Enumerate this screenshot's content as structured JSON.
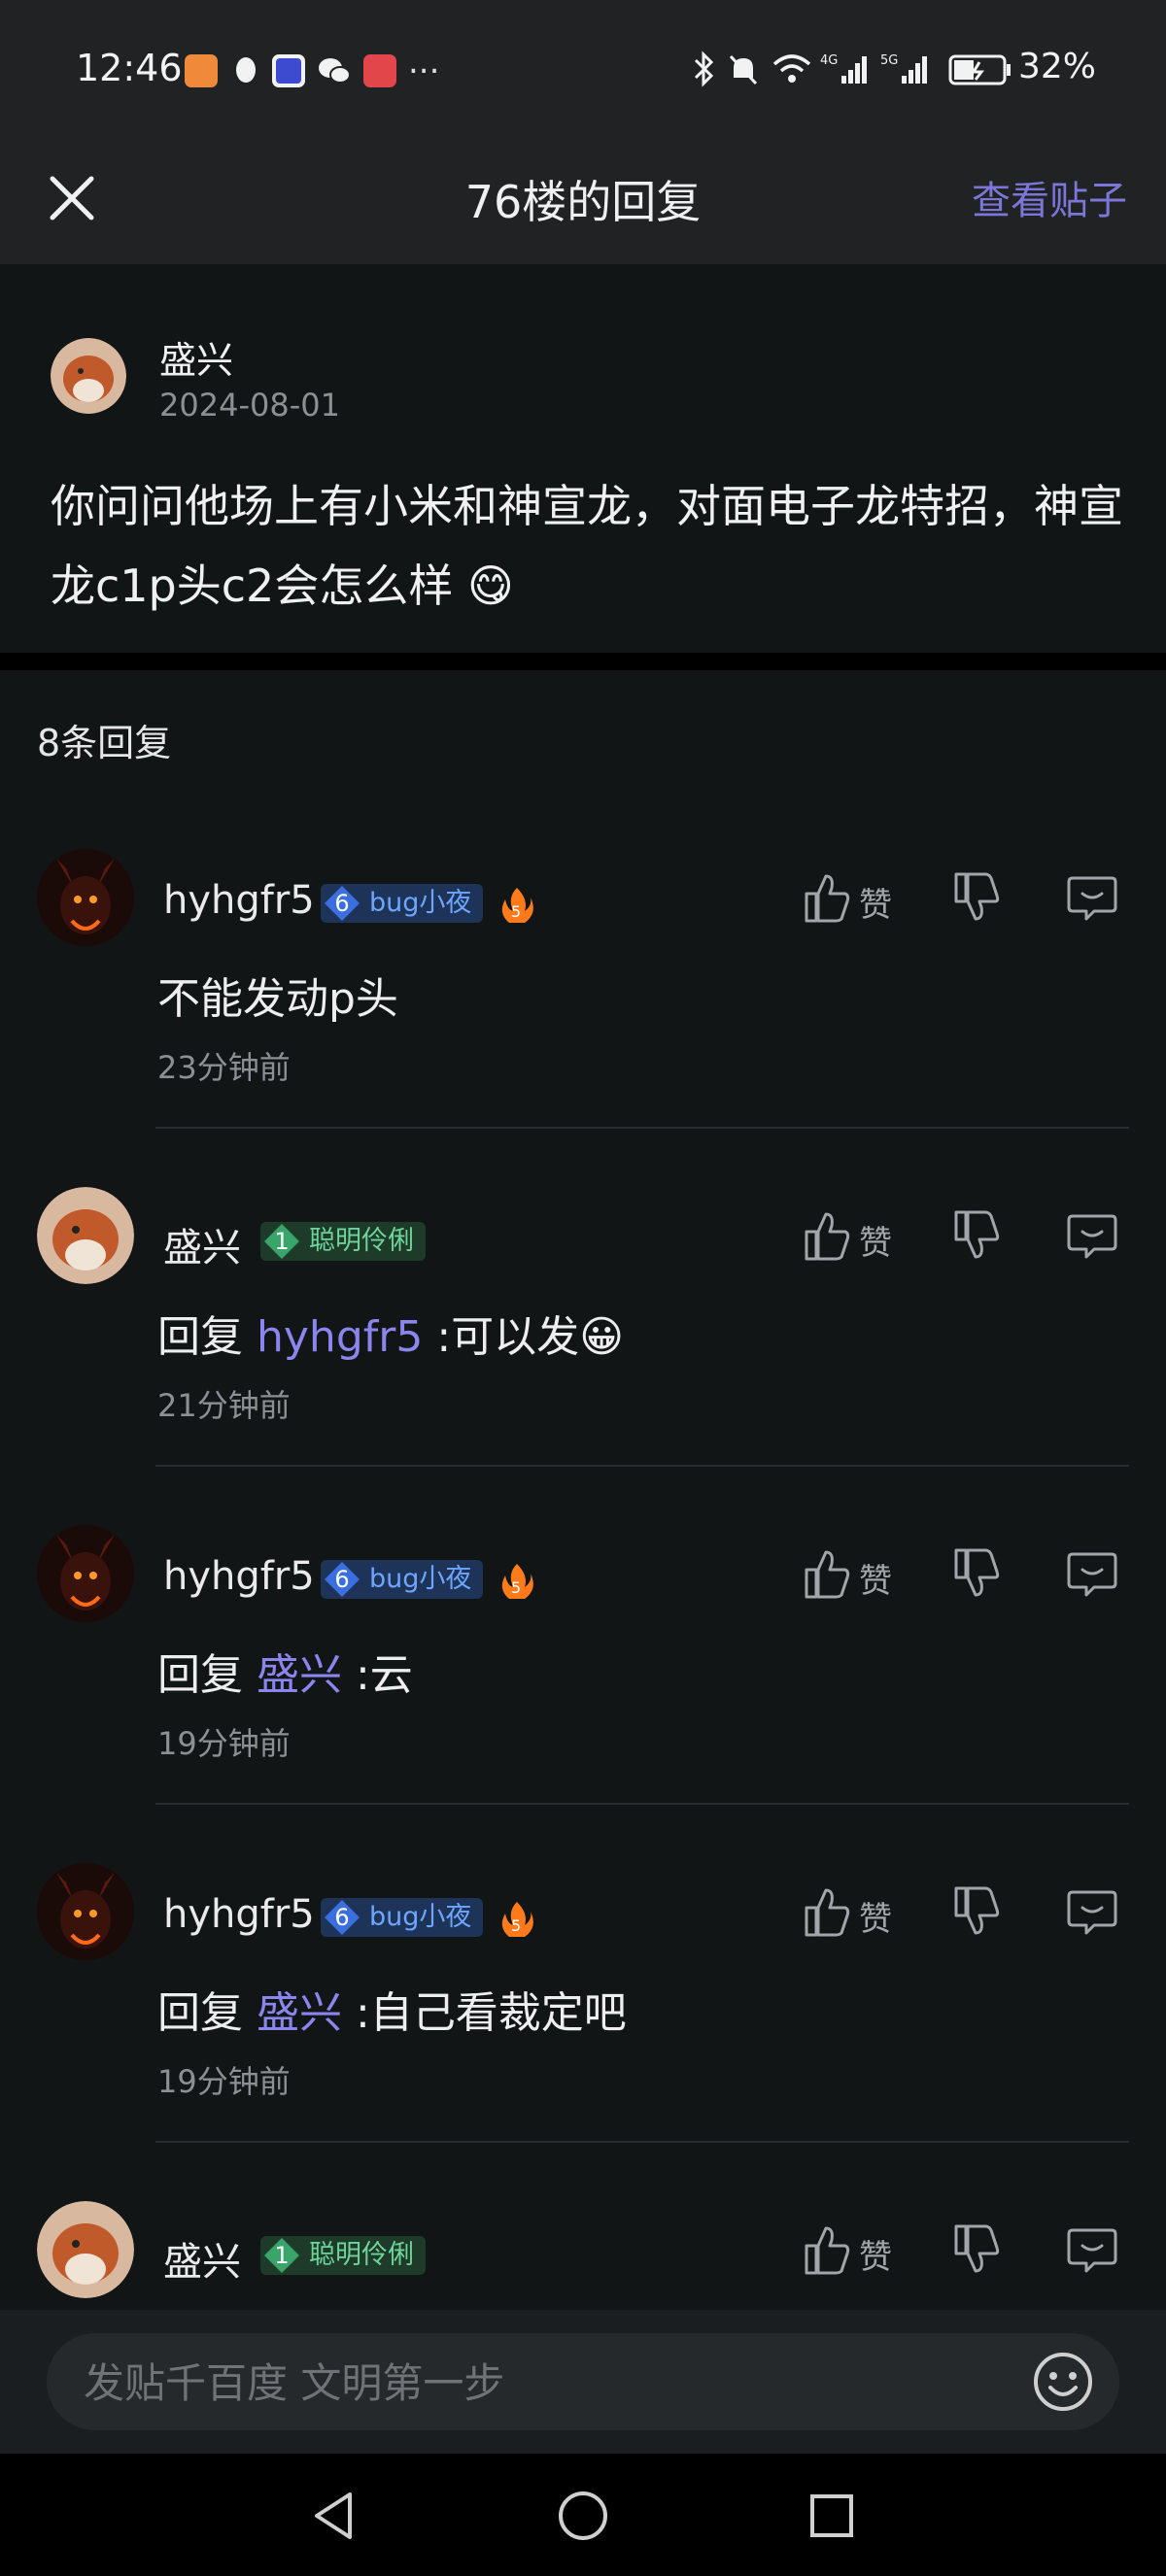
{
  "status_bar": {
    "time": "12:46",
    "network": "4G 5G",
    "battery": "32%",
    "more_icon": "..."
  },
  "header": {
    "title": "76楼的回复",
    "view_post": "查看贴子"
  },
  "post": {
    "author": "盛兴",
    "date": "2024-08-01",
    "text": "你问问他场上有小米和神宣龙，对面电子龙特招，神宣龙c1p头c2会怎么样 😋"
  },
  "replies_count": "8条回复",
  "like_label": "赞",
  "replies": [
    {
      "author": "hyhgfr5",
      "level": "6",
      "badge": "bug小夜",
      "badge_color": "blue",
      "fire": "5",
      "prefix": "",
      "mention": "",
      "text": "不能发动p头",
      "time": "23分钟前"
    },
    {
      "author": "盛兴",
      "level": "1",
      "badge": "聪明伶俐",
      "badge_color": "green",
      "fire": "",
      "prefix": "回复 ",
      "mention": "hyhgfr5",
      "text": " :可以发😀",
      "time": "21分钟前"
    },
    {
      "author": "hyhgfr5",
      "level": "6",
      "badge": "bug小夜",
      "badge_color": "blue",
      "fire": "5",
      "prefix": "回复 ",
      "mention": "盛兴",
      "text": " :云",
      "time": "19分钟前"
    },
    {
      "author": "hyhgfr5",
      "level": "6",
      "badge": "bug小夜",
      "badge_color": "blue",
      "fire": "5",
      "prefix": "回复 ",
      "mention": "盛兴",
      "text": " :自己看裁定吧",
      "time": "19分钟前"
    },
    {
      "author": "盛兴",
      "level": "1",
      "badge": "聪明伶俐",
      "badge_color": "green",
      "fire": "",
      "prefix": "",
      "mention": "",
      "text": "",
      "time": ""
    }
  ],
  "input": {
    "placeholder": "发贴千百度 文明第一步"
  },
  "colors": {
    "accent": "#7b76d8",
    "background": "#121516",
    "bar": "#202224"
  }
}
